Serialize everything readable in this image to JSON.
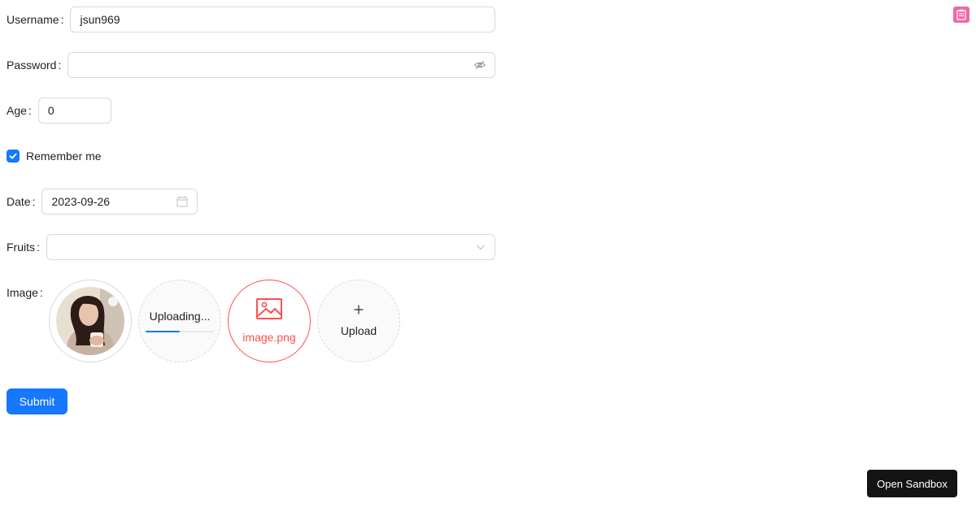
{
  "form": {
    "username": {
      "label": "Username",
      "value": "jsun969"
    },
    "password": {
      "label": "Password",
      "value": "",
      "suffix_icon": "eye-invisible-icon"
    },
    "age": {
      "label": "Age",
      "value": "0"
    },
    "remember": {
      "label": "Remember me",
      "checked": true
    },
    "date": {
      "label": "Date",
      "value": "2023-09-26",
      "suffix_icon": "calendar-icon"
    },
    "fruits": {
      "label": "Fruits",
      "value": "",
      "suffix_icon": "chevron-down-icon"
    },
    "image": {
      "label": "Image",
      "items": [
        {
          "status": "done",
          "kind": "avatar-photo"
        },
        {
          "status": "uploading",
          "text": "Uploading...",
          "progress": 0.5
        },
        {
          "status": "error",
          "name": "image.png",
          "icon": "picture-icon"
        },
        {
          "status": "upload",
          "text": "Upload",
          "icon": "plus-icon"
        }
      ]
    },
    "submit_label": "Submit"
  },
  "colon": ":",
  "sandbox_label": "Open Sandbox",
  "corner_icon": "clipboard-icon",
  "colors": {
    "primary": "#1677ff",
    "error": "#ff4d4f",
    "sandbox_bg": "#141414",
    "corner_icon_bg": "#eb6aa5"
  }
}
